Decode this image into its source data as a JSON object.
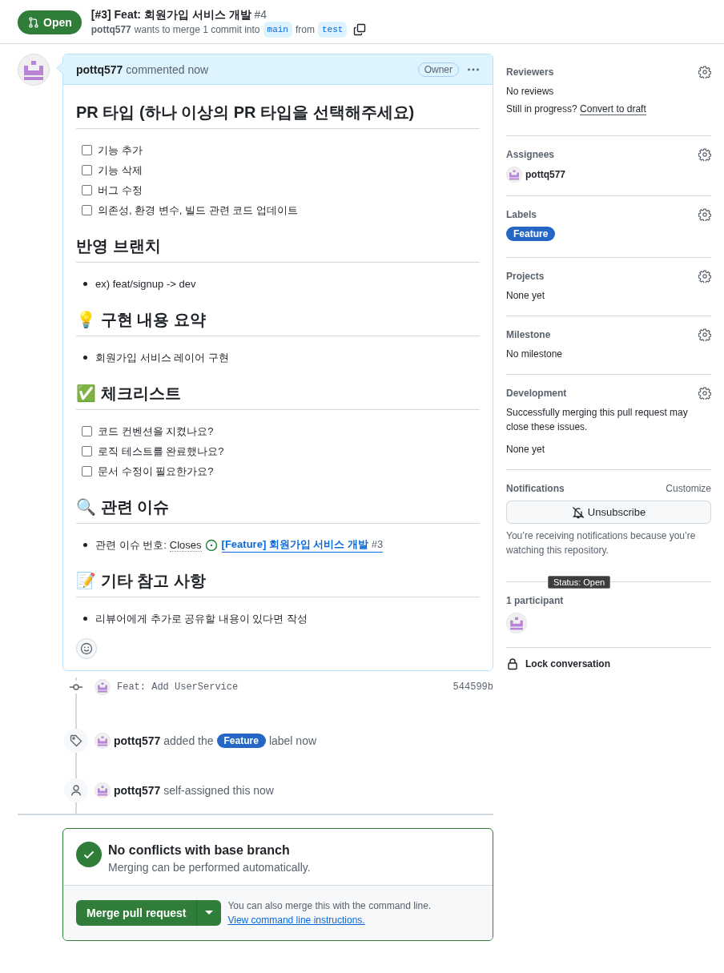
{
  "header": {
    "state": "Open",
    "title": "[#3] Feat: 회원가입 서비스 개발",
    "number": "#4",
    "author": "pottq577",
    "merge_text": "wants to merge 1 commit into",
    "base": "main",
    "from_text": "from",
    "head": "test"
  },
  "comment": {
    "author": "pottq577",
    "action": "commented now",
    "role": "Owner",
    "blocks": [
      {
        "kind": "heading",
        "text": "PR 타입 (하나 이상의 PR 타입을 선택해주세요)"
      },
      {
        "kind": "checklist",
        "items": [
          {
            "label": "기능 추가",
            "checked": false
          },
          {
            "label": "기능 삭제",
            "checked": false
          },
          {
            "label": "버그 수정",
            "checked": false
          },
          {
            "label": "의존성, 환경 변수, 빌드 관련 코드 업데이트",
            "checked": false
          }
        ]
      },
      {
        "kind": "heading",
        "text": "반영 브랜치"
      },
      {
        "kind": "bullets",
        "items": [
          "ex) feat/signup -> dev"
        ]
      },
      {
        "kind": "heading",
        "text": "💡 구현 내용 요약"
      },
      {
        "kind": "bullets",
        "items": [
          "회원가입 서비스 레이어 구현"
        ]
      },
      {
        "kind": "heading",
        "text": "✅ 체크리스트"
      },
      {
        "kind": "checklist",
        "items": [
          {
            "label": "코드 컨벤션을 지켰나요?",
            "checked": false
          },
          {
            "label": "로직 테스트를 완료했나요?",
            "checked": false
          },
          {
            "label": "문서 수정이 필요한가요?",
            "checked": false
          }
        ]
      },
      {
        "kind": "heading",
        "text": "🔍 관련 이슈"
      },
      {
        "kind": "issue",
        "prefix": "관련 이슈 번호:",
        "closes": "Closes",
        "link": "[Feature] 회원가입 서비스 개발",
        "number": "#3"
      },
      {
        "kind": "heading",
        "text": "📝 기타 참고 사항"
      },
      {
        "kind": "bullets",
        "items": [
          "리뷰어에게 추가로 공유할 내용이 있다면 작성"
        ]
      }
    ]
  },
  "timeline": [
    {
      "kind": "commit",
      "message": "Feat: Add UserService",
      "sha": "544599b"
    },
    {
      "kind": "label",
      "author": "pottq577",
      "before": "added the",
      "label": "Feature",
      "after": "label now"
    },
    {
      "kind": "assign",
      "author": "pottq577",
      "text": "self-assigned this now"
    }
  ],
  "merge": {
    "title": "No conflicts with base branch",
    "subtitle": "Merging can be performed automatically.",
    "button": "Merge pull request",
    "hint": "You can also merge this with the command line.",
    "link": "View command line instructions."
  },
  "sidebar": [
    {
      "kind": "reviewers",
      "title": "Reviewers",
      "empty": "No reviews",
      "prompt": "Still in progress?",
      "link": "Convert to draft"
    },
    {
      "kind": "assignees",
      "title": "Assignees",
      "user": "pottq577"
    },
    {
      "kind": "labels",
      "title": "Labels",
      "label": "Feature"
    },
    {
      "kind": "text",
      "title": "Projects",
      "text": "None yet"
    },
    {
      "kind": "text",
      "title": "Milestone",
      "text": "No milestone"
    },
    {
      "kind": "development",
      "title": "Development",
      "text": "Successfully merging this pull request may close these issues.",
      "empty": "None yet"
    },
    {
      "kind": "notifications",
      "title": "Notifications",
      "action": "Customize",
      "button": "Unsubscribe",
      "text": "You’re receiving notifications because you’re watching this repository.",
      "tooltip": "Status: Open"
    },
    {
      "kind": "participants",
      "title": "1 participant"
    },
    {
      "kind": "lock",
      "text": "Lock conversation"
    }
  ]
}
